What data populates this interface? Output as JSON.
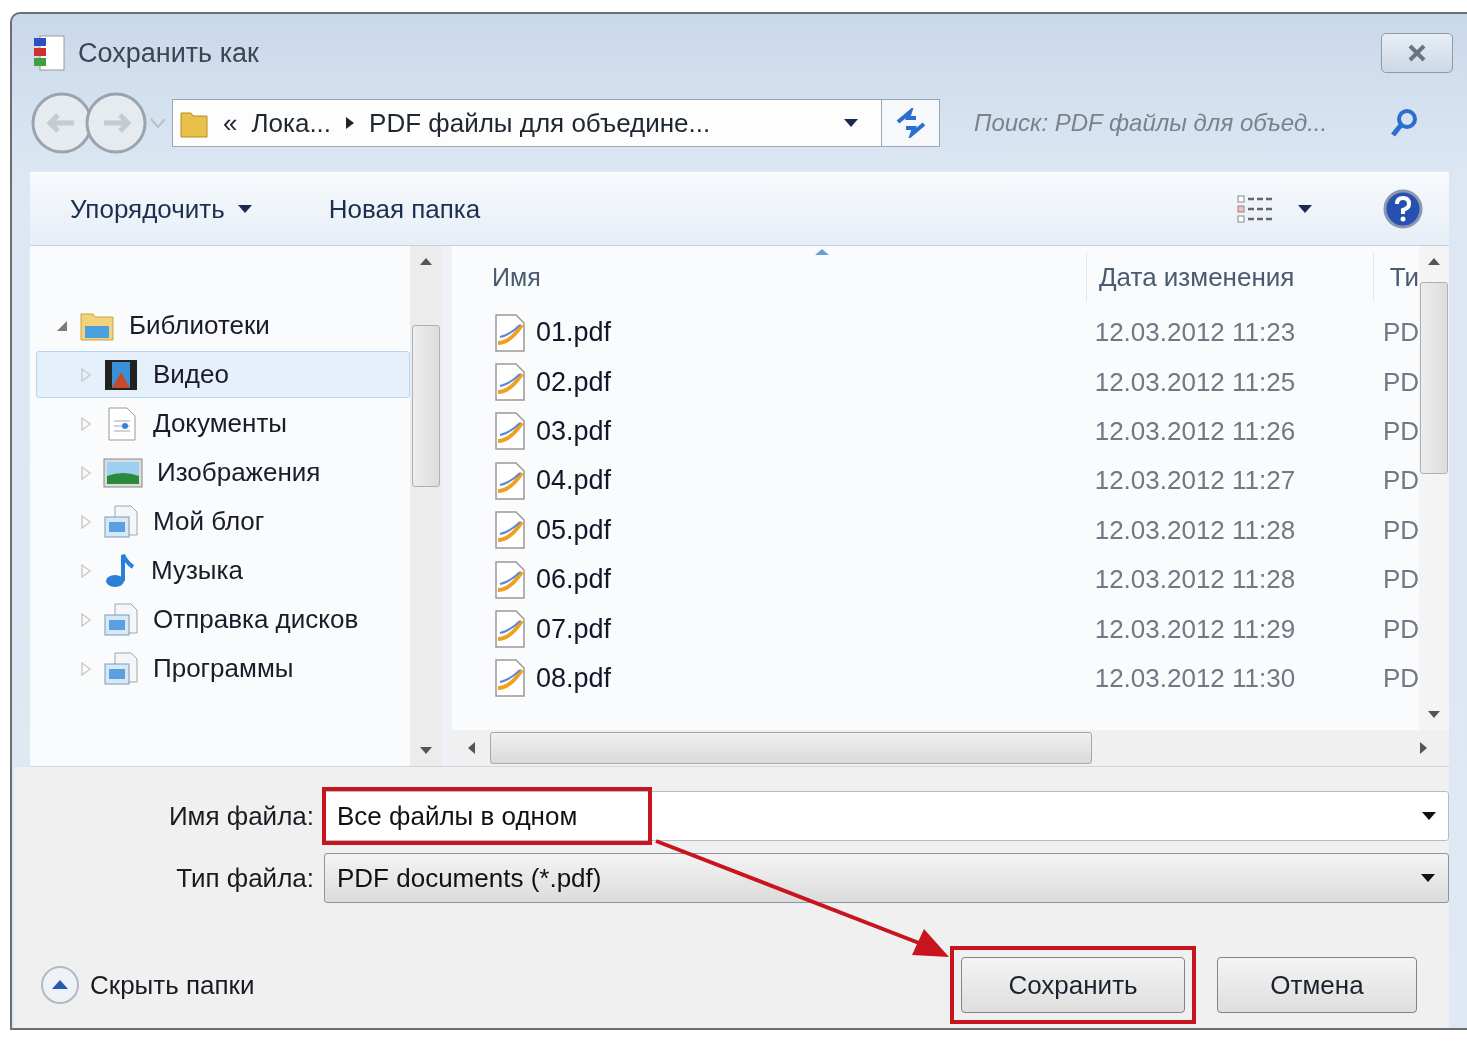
{
  "window": {
    "title": "Сохранить как"
  },
  "address": {
    "crumbs": [
      "«",
      "Лока...",
      "PDF файлы для объедине..."
    ]
  },
  "search": {
    "placeholder": "Поиск: PDF файлы для объед..."
  },
  "toolbar": {
    "items": [
      {
        "label": "Упорядочить",
        "dropdown": true
      },
      {
        "label": "Новая папка",
        "dropdown": false
      }
    ]
  },
  "sidebar": {
    "items": [
      {
        "label": "Библиотеки",
        "kind": "library",
        "expanded": true,
        "selected": false,
        "children": [
          {
            "label": "Видео",
            "kind": "video",
            "expanded": false,
            "selected": true
          },
          {
            "label": "Документы",
            "kind": "documents",
            "expanded": false,
            "selected": false
          },
          {
            "label": "Изображения",
            "kind": "images",
            "expanded": false,
            "selected": false
          },
          {
            "label": "Мой блог",
            "kind": "folder",
            "expanded": false,
            "selected": false
          },
          {
            "label": "Музыка",
            "kind": "music",
            "expanded": false,
            "selected": false
          },
          {
            "label": "Отправка дисков",
            "kind": "folder",
            "expanded": false,
            "selected": false
          },
          {
            "label": "Программы",
            "kind": "folder",
            "expanded": false,
            "selected": false
          }
        ]
      }
    ]
  },
  "table": {
    "columns": [
      "Имя",
      "Дата изменения",
      "Ти"
    ],
    "rows": [
      {
        "name": "01.pdf",
        "date": "12.03.2012 11:23",
        "type": "PD"
      },
      {
        "name": "02.pdf",
        "date": "12.03.2012 11:25",
        "type": "PD"
      },
      {
        "name": "03.pdf",
        "date": "12.03.2012 11:26",
        "type": "PD"
      },
      {
        "name": "04.pdf",
        "date": "12.03.2012 11:27",
        "type": "PD"
      },
      {
        "name": "05.pdf",
        "date": "12.03.2012 11:28",
        "type": "PD"
      },
      {
        "name": "06.pdf",
        "date": "12.03.2012 11:28",
        "type": "PD"
      },
      {
        "name": "07.pdf",
        "date": "12.03.2012 11:29",
        "type": "PD"
      },
      {
        "name": "08.pdf",
        "date": "12.03.2012 11:30",
        "type": "PD"
      }
    ]
  },
  "file_name": {
    "label": "Имя файла:",
    "value": "Все файлы в одном",
    "highlighted": true
  },
  "file_type": {
    "label": "Тип файла:",
    "value": "PDF documents (*.pdf)"
  },
  "hide_folders": "Скрыть папки",
  "buttons": [
    {
      "label": "Сохранить",
      "highlighted": true
    },
    {
      "label": "Отмена",
      "highlighted": false
    }
  ]
}
